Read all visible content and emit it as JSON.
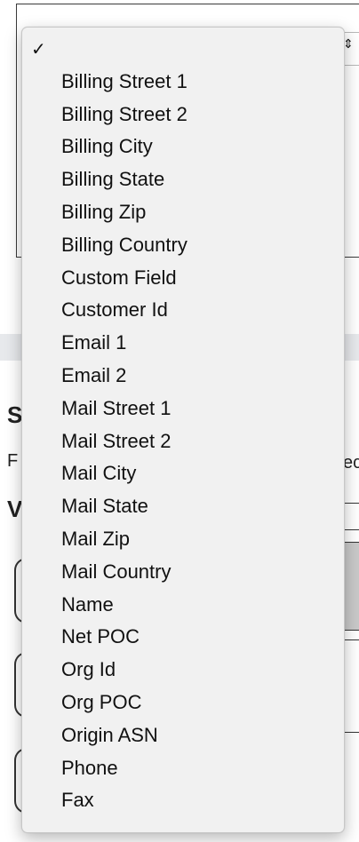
{
  "background": {
    "select_arrows": "⇕",
    "section_letter_s": "S",
    "text_letter_f": "F",
    "heading_letter_v": "V",
    "right_text_fragment": "ec"
  },
  "menu": {
    "selected_marker": "✓",
    "items": [
      {
        "label": ""
      },
      {
        "label": "Billing Street 1"
      },
      {
        "label": "Billing Street 2"
      },
      {
        "label": "Billing City"
      },
      {
        "label": "Billing State"
      },
      {
        "label": "Billing Zip"
      },
      {
        "label": "Billing Country"
      },
      {
        "label": "Custom Field"
      },
      {
        "label": "Customer Id"
      },
      {
        "label": "Email 1"
      },
      {
        "label": "Email 2"
      },
      {
        "label": "Mail Street 1"
      },
      {
        "label": "Mail Street 2"
      },
      {
        "label": "Mail City"
      },
      {
        "label": "Mail State"
      },
      {
        "label": "Mail Zip"
      },
      {
        "label": "Mail Country"
      },
      {
        "label": "Name"
      },
      {
        "label": "Net POC"
      },
      {
        "label": "Org Id"
      },
      {
        "label": "Org POC"
      },
      {
        "label": "Origin ASN"
      },
      {
        "label": "Phone"
      },
      {
        "label": "Fax"
      }
    ]
  }
}
